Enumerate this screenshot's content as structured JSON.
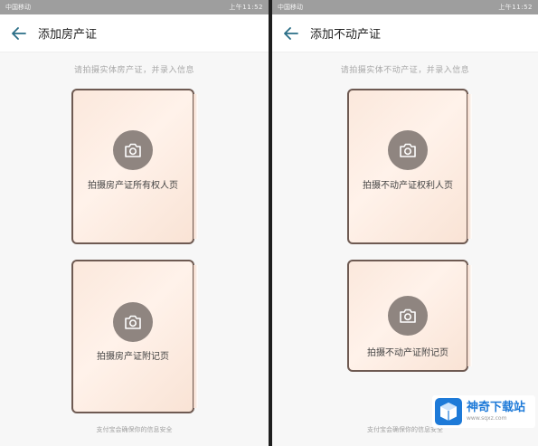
{
  "left": {
    "status": {
      "carrier": "中国移动",
      "time": "上午11:52"
    },
    "title": "添加房产证",
    "hint": "请拍摄实体房产证，并录入信息",
    "cards": [
      {
        "label": "拍摄房产证所有权人页"
      },
      {
        "label": "拍摄房产证附记页"
      }
    ],
    "footer": "支付宝会确保你的信息安全"
  },
  "right": {
    "status": {
      "carrier": "中国移动",
      "time": "上午11:52"
    },
    "title": "添加不动产证",
    "hint": "请拍摄实体不动产证，并录入信息",
    "cards": [
      {
        "label": "拍摄不动产证权利人页"
      },
      {
        "label": "拍摄不动产证附记页"
      }
    ],
    "footer": "支付宝会确保你的信息安全"
  },
  "watermark": {
    "name": "神奇下载站",
    "url": "www.sqxz.com"
  },
  "colors": {
    "back_arrow": "#2a6e87",
    "card_border": "#6e5a52",
    "camera_bg": "#8f8580",
    "watermark_blue": "#1e7ad8"
  }
}
